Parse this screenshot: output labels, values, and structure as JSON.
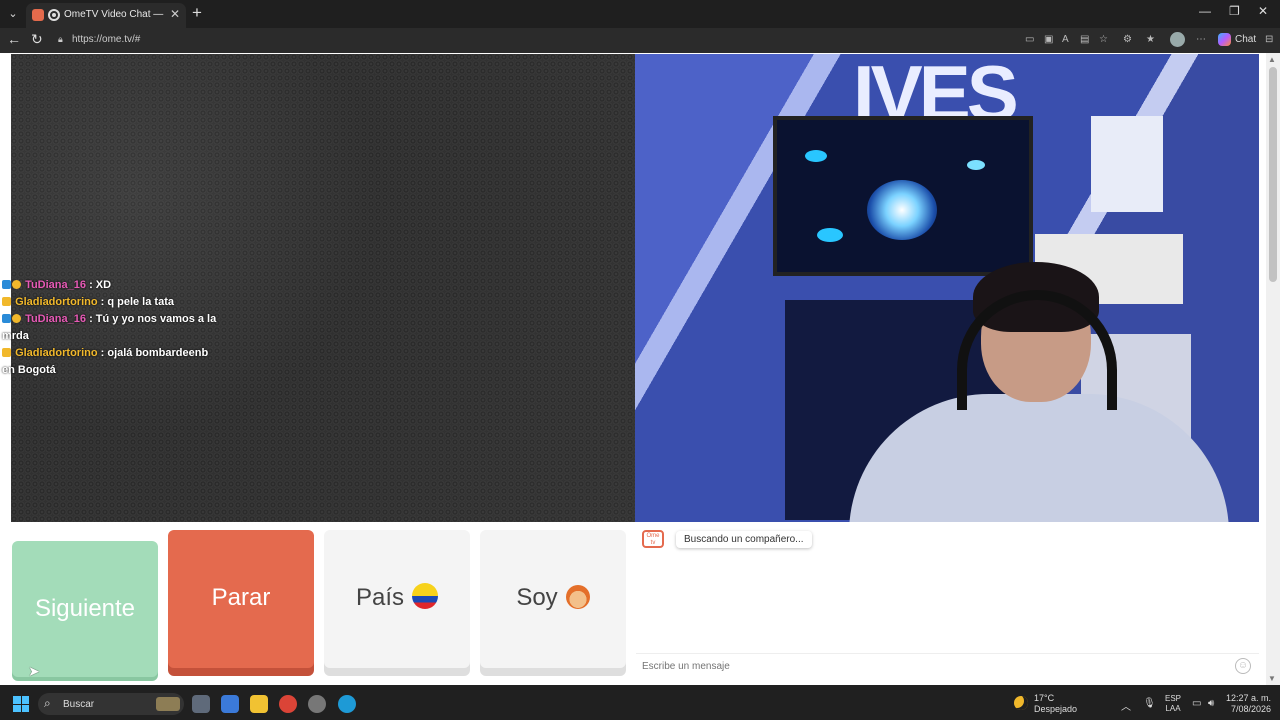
{
  "browser": {
    "tab_title": "OmeTV Video Chat — Omegle",
    "tab_close": "✕",
    "new_tab": "+",
    "url": "https://ome.tv/#",
    "copilot_label": "Chat",
    "window_controls": {
      "minimize": "—",
      "maximize": "❐",
      "close": "✕"
    },
    "nav": {
      "back": "←",
      "reload": "↻"
    }
  },
  "stranger_chat": [
    {
      "user": "TuDiana_16",
      "text": ": XD",
      "user_color": "#e75ab6"
    },
    {
      "user": "Gladiadortorino",
      "text": ": q pele la tata",
      "user_color": "#f1b82b"
    },
    {
      "user": "TuDiana_16",
      "text": ": Tú y yo nos vamos a la",
      "continuation": "mrda",
      "user_color": "#e75ab6"
    },
    {
      "user": "Gladiadortorino",
      "text": ": ojalá bombardeenb",
      "continuation": "en Bogotá",
      "user_color": "#f1b82b"
    }
  ],
  "self_video": {
    "logo_text": "IVES"
  },
  "controls": {
    "next": "Siguiente",
    "stop": "Parar",
    "country": "País",
    "soy": "Soy"
  },
  "chat_panel": {
    "logo_text": "Ome tv",
    "status": "Buscando un compañero...",
    "input_placeholder": "Escribe un mensaje"
  },
  "taskbar": {
    "search_label": "Buscar",
    "weather_temp": "17°C",
    "weather_desc": "Despejado",
    "lang_1": "ESP",
    "lang_2": "LAA",
    "time": "12:27 a. m.",
    "date": "7/08/2026"
  },
  "colors": {
    "accent_next": "#a3dcb9",
    "accent_stop": "#e46a4e",
    "user_pink": "#e75ab6",
    "user_gold": "#f1b82b"
  }
}
